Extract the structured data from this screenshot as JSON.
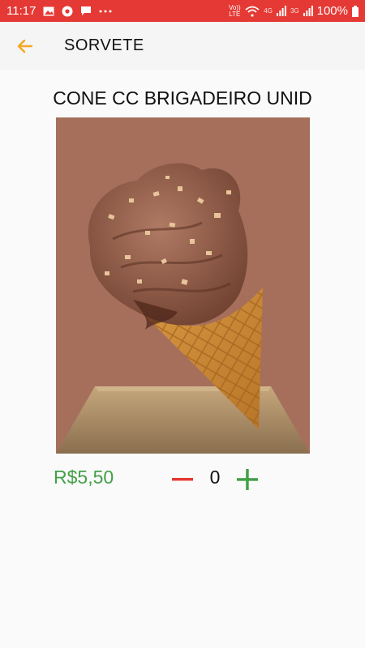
{
  "status_bar": {
    "time": "11:17",
    "icons_left": [
      "image-icon",
      "chrome-icon",
      "message-icon",
      "more-icon"
    ],
    "net_volte": "Vo)) LTE",
    "net_4g": "4G",
    "net_3g": "3G",
    "battery": "100%"
  },
  "app_bar": {
    "back_icon": "arrow-back-icon",
    "title": "SORVETE"
  },
  "product": {
    "name": "CONE CC BRIGADEIRO UNID",
    "price": "R$5,50",
    "quantity": "0"
  },
  "colors": {
    "status_bar": "#e53935",
    "accent_orange": "#f5a623",
    "price_green": "#43a047",
    "minus_red": "#e53935",
    "plus_green": "#43a047"
  }
}
